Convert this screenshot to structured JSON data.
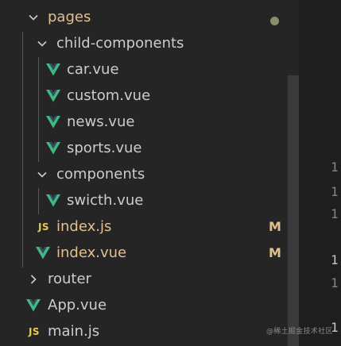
{
  "tree": {
    "pages": "pages",
    "child_components": "child-components",
    "car": "car.vue",
    "custom": "custom.vue",
    "news": "news.vue",
    "sports": "sports.vue",
    "components": "components",
    "switch": "swicth.vue",
    "index_js": "index.js",
    "index_vue": "index.vue",
    "router": "router",
    "app": "App.vue",
    "main": "main.js"
  },
  "badges": {
    "index_js": "M",
    "index_vue": "M"
  },
  "icons": {
    "vue": "vue-icon",
    "js": "JS",
    "folder_open": "chevron-down-icon",
    "folder_closed": "chevron-right-icon"
  },
  "editor": {
    "line_numbers": [
      "1",
      "1",
      "1",
      "1",
      "1",
      "1"
    ]
  },
  "watermark": "@稀土掘金技术社区",
  "colors": {
    "background": "#252526",
    "text": "#cccccc",
    "modified": "#e2c08d",
    "vue_green": "#41b883",
    "js_yellow": "#e8c94a"
  }
}
